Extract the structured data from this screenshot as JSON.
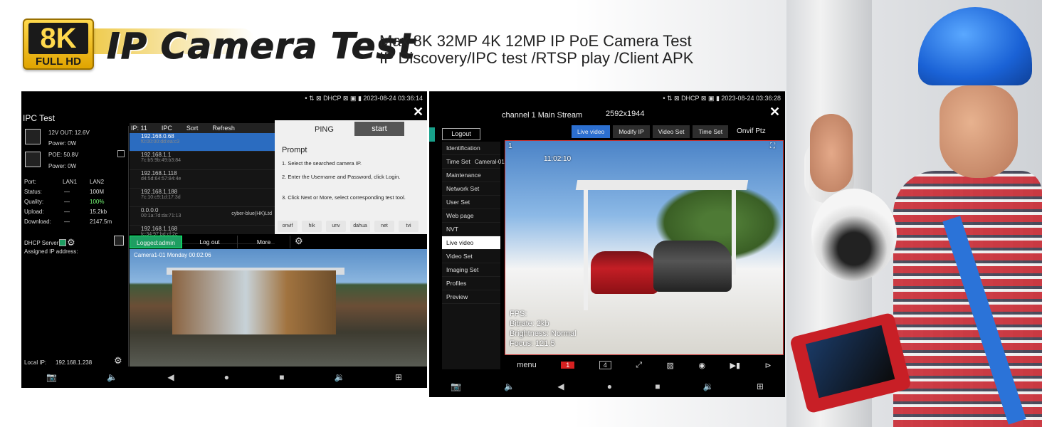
{
  "header": {
    "badge_top": "8K",
    "badge_bottom": "FULL HD",
    "title": "IP Camera Test",
    "subtitle_line1": "Max 8K 32MP 4K 12MP IP PoE Camera Test",
    "subtitle_line2": "IP Discovery/IPC test /RTSP play /Client APK"
  },
  "device1": {
    "status_time": "2023-08-24 03:36:14",
    "status_icons": "• ⇅ ⊠ DHCP ⊠ ▣ ▮",
    "title": "IPC Test",
    "power": {
      "v12_label": "12V OUT: 12.6V",
      "v12_power": "Power: 0W",
      "poe_label": "POE: 50.8V",
      "poe_power": "Power: 0W"
    },
    "port_table": {
      "headers": [
        "Port:",
        "LAN1",
        "LAN2"
      ],
      "rows": [
        [
          "Status:",
          "—",
          "100M"
        ],
        [
          "Quality:",
          "—",
          "100%"
        ],
        [
          "Upload:",
          "—",
          "15.2kb"
        ],
        [
          "Download:",
          "—",
          "2147.5m"
        ]
      ]
    },
    "dhcp_server": "DHCP Server:",
    "assigned_ip": "Assigned IP address:",
    "local_ip_label": "Local IP:",
    "local_ip": "192.168.1.238",
    "list_header": {
      "count": "IP: 11",
      "ipc": "IPC",
      "sort": "Sort",
      "refresh": "Refresh"
    },
    "ip_items": [
      {
        "ip": "192.168.0.68",
        "mac": "f0:00:00:dd:ea:c3",
        "selected": true,
        "vendor": ""
      },
      {
        "ip": "192.168.1.1",
        "mac": "7c:b5:9b:49:b3:84",
        "selected": false,
        "vendor": ""
      },
      {
        "ip": "192.168.1.118",
        "mac": "d4:5d:64:57:84:4e",
        "selected": false,
        "vendor": ""
      },
      {
        "ip": "192.168.1.188",
        "mac": "7c:10:c9:1d:17:3d",
        "selected": false,
        "vendor": ""
      },
      {
        "ip": "0.0.0.0",
        "mac": "00:1a:7d:da:71:13",
        "selected": false,
        "vendor": "cyber-blue(HK)Ltd"
      },
      {
        "ip": "192.168.1.168",
        "mac": "fc:34:97:bd:cf:2e",
        "selected": false,
        "vendor": ""
      }
    ],
    "ping": {
      "label": "PING",
      "start": "start"
    },
    "prompt_title": "Prompt",
    "prompt_steps": [
      "1. Select the searched camera IP.",
      "2. Enter the Username and Password, click Login.",
      "3. Click Next or More, select corresponding test tool."
    ],
    "brands": [
      "onvif",
      "hik",
      "unv",
      "dahua",
      "net",
      "tvi"
    ],
    "toolbar": {
      "logged": "Logged:admin",
      "logout": "Log out",
      "more": "More"
    },
    "osd": "Camera1-01 Monday 00:02:06",
    "nav": [
      "📷",
      "🔈",
      "◀",
      "●",
      "■",
      "🔉",
      "⊞"
    ]
  },
  "device2": {
    "status_time": "2023-08-24 03:36:28",
    "status_icons": "• ⇅ ⊠ DHCP ⊠ ▣ ▮",
    "channel": "channel 1  Main Stream",
    "resolution": "2592x1944",
    "logout": "Logout",
    "tabs": [
      {
        "label": "Live video",
        "active": true
      },
      {
        "label": "Modify IP",
        "active": false
      },
      {
        "label": "Video Set",
        "active": false
      },
      {
        "label": "Time Set",
        "active": false
      },
      {
        "label": "Onvif Ptz",
        "active": false,
        "plain": true
      }
    ],
    "menu": [
      {
        "label": "Identification",
        "active": false
      },
      {
        "label": "Time Set",
        "active": false
      },
      {
        "label": "Maintenance",
        "active": false
      },
      {
        "label": "Network Set",
        "active": false
      },
      {
        "label": "User Set",
        "active": false
      },
      {
        "label": "Web page",
        "active": false
      },
      {
        "label": "NVT",
        "active": false
      },
      {
        "label": "Live video",
        "active": true
      },
      {
        "label": "Video Set",
        "active": false
      },
      {
        "label": "Imaging Set",
        "active": false
      },
      {
        "label": "Profiles",
        "active": false
      },
      {
        "label": "Preview",
        "active": false
      }
    ],
    "camera_name": "Cameral-01",
    "osd_time": "11:02:10",
    "osd_channel": "1",
    "info_lines": [
      "FPS:",
      "Bitrate: 2kb",
      "Brightness: Normal",
      "Focus: 121.5"
    ],
    "bottom": {
      "menu": "menu",
      "one": "1",
      "four": "4"
    },
    "nav": [
      "📷",
      "🔈",
      "◀",
      "●",
      "■",
      "🔉",
      "⊞"
    ]
  }
}
